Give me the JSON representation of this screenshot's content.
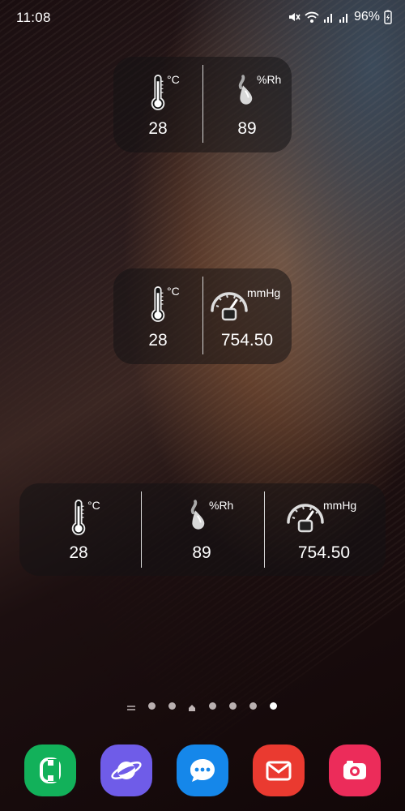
{
  "status_bar": {
    "time": "11:08",
    "battery": "96%",
    "icons": [
      "mute-icon",
      "wifi-icon",
      "signal-icon",
      "signal-icon",
      "battery-charging-icon"
    ]
  },
  "widgets": {
    "temp_humidity": {
      "temperature": {
        "unit": "°C",
        "value": "28",
        "icon": "thermometer-icon"
      },
      "humidity": {
        "unit": "%Rh",
        "value": "89",
        "icon": "water-drop-icon"
      }
    },
    "temp_pressure": {
      "temperature": {
        "unit": "°C",
        "value": "28",
        "icon": "thermometer-icon"
      },
      "pressure": {
        "unit": "mmHg",
        "value": "754.50",
        "icon": "barometer-gauge-icon"
      }
    },
    "combined": {
      "temperature": {
        "unit": "°C",
        "value": "28",
        "icon": "thermometer-icon"
      },
      "humidity": {
        "unit": "%Rh",
        "value": "89",
        "icon": "water-drop-icon"
      },
      "pressure": {
        "unit": "mmHg",
        "value": "754.50",
        "icon": "barometer-gauge-icon"
      }
    }
  },
  "pager": {
    "page_count": 7,
    "active_page": 7
  },
  "dock": {
    "apps": [
      {
        "name": "phone",
        "icon": "phone-icon",
        "color": "#1db954"
      },
      {
        "name": "internet",
        "icon": "planet-icon",
        "color": "#7b6cf0"
      },
      {
        "name": "messages",
        "icon": "chat-bubble-icon",
        "color": "#1a8df0"
      },
      {
        "name": "email",
        "icon": "envelope-icon",
        "color": "#f0473a"
      },
      {
        "name": "camera",
        "icon": "camera-icon",
        "color": "#f0315e"
      }
    ]
  }
}
